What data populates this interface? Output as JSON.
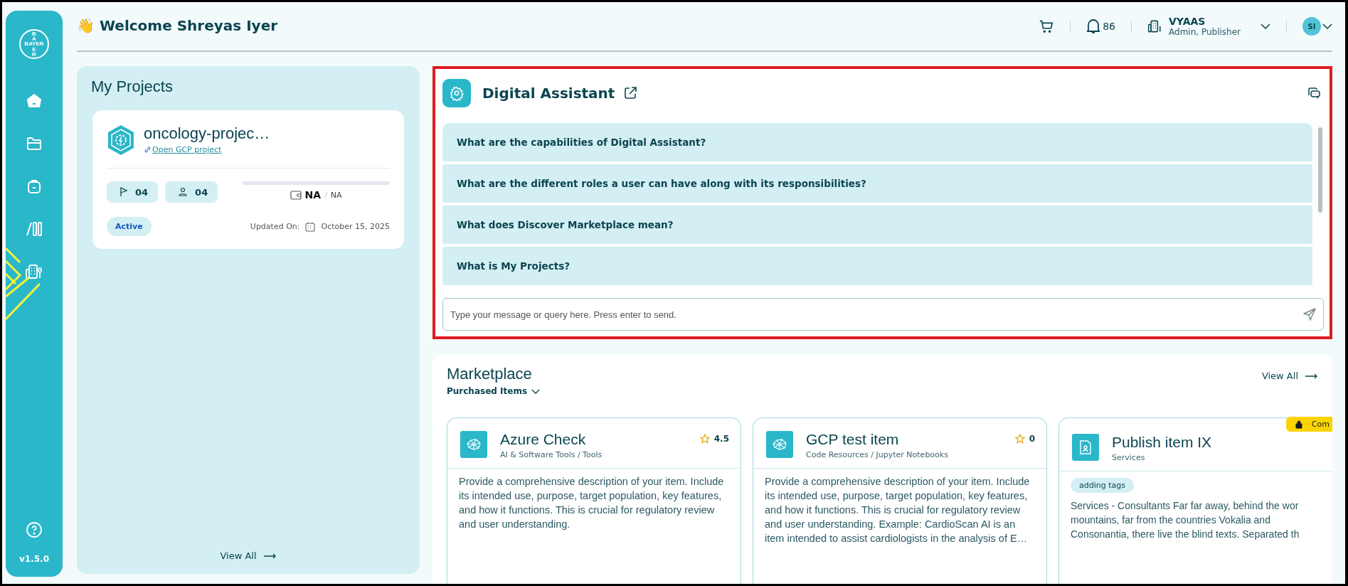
{
  "sidebar": {
    "logo": {
      "across": "BAYER",
      "top": "BA",
      "bottom": "ER"
    },
    "nav": [
      {
        "kind": "home"
      },
      {
        "kind": "folder"
      },
      {
        "kind": "bag"
      },
      {
        "kind": "library"
      },
      {
        "kind": "building"
      }
    ],
    "version": "v1.5.0"
  },
  "header": {
    "wave": "👋",
    "title": "Welcome Shreyas Iyer",
    "notifications": "86",
    "org": {
      "name": "VYAAS",
      "roles": "Admin, Publisher"
    },
    "avatar": "SI"
  },
  "projects": {
    "title": "My Projects",
    "items": [
      {
        "name": "oncology-projec…",
        "link": "Open GCP project",
        "milestones": "04",
        "members": "04",
        "level": 0,
        "budget_used": "NA",
        "budget_separator": "/",
        "budget_total": "NA",
        "status": "Active",
        "updated_label": "Updated On:",
        "updated_date": "October 15, 2025"
      }
    ],
    "view_all": "View All"
  },
  "assistant": {
    "title": "Digital Assistant",
    "highlighted": true,
    "questions": [
      "What are the capabilities of Digital Assistant?",
      "What are the different roles a user can have along with its responsibilities?",
      "What does Discover Marketplace mean?",
      "What is My Projects?"
    ],
    "input": {
      "placeholder": "Type your message or query here. Press enter to send."
    }
  },
  "marketplace": {
    "title": "Marketplace",
    "filter": "Purchased Items",
    "view_all": "View All",
    "items": [
      {
        "kind": "tool",
        "title": "Azure Check",
        "category": "AI & Software Tools / Tools",
        "rating": "4.5",
        "description": [
          "Provide a comprehensive description of your item. Include its intended use, purpose, target population, key features, and how it functions. This is crucial for regulatory review and user understanding."
        ]
      },
      {
        "kind": "tool",
        "title": "GCP test item",
        "category": "Code Resources / Jupyter Notebooks",
        "rating": "0",
        "description": [
          "Provide a comprehensive description of your item. Include its intended use, purpose, target population, key features, and how it functions. This is crucial for regulatory review and user understanding. Example: CardioScan AI is an item intended to assist cardiologists in the analysis of E…"
        ]
      },
      {
        "kind": "service",
        "title": "Publish item IX",
        "category": "Services",
        "badge": "Com",
        "tag": "adding tags",
        "description": [
          "Services - Consultants Far far away, behind the wor",
          "mountains, far from the countries Vokalia and",
          "Consonantia, there live the blind texts. Separated th"
        ]
      }
    ]
  }
}
